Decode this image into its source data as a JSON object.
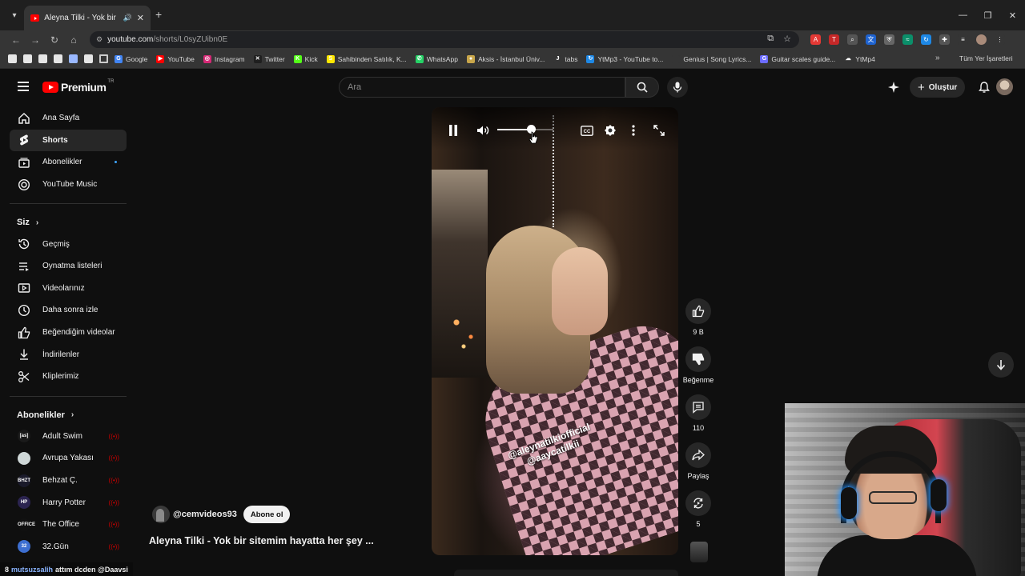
{
  "browser": {
    "tab_title": "Aleyna Tilki - Yok bir sitemim hayatta her şey",
    "url_host": "youtube.com",
    "url_path": "/shorts/L0syZUibn0E",
    "bookmarks": [
      {
        "label": "Google",
        "color": "#4285f4",
        "glyph": "G"
      },
      {
        "label": "YouTube",
        "color": "#ff0000",
        "glyph": "▶"
      },
      {
        "label": "Instagram",
        "color": "#d62976",
        "glyph": "◎"
      },
      {
        "label": "Twitter",
        "color": "#1f1f1f",
        "glyph": "✕"
      },
      {
        "label": "Kick",
        "color": "#53fc18",
        "glyph": "K"
      },
      {
        "label": "Sahibinden Satılık, K...",
        "color": "#ffe800",
        "glyph": "S"
      },
      {
        "label": "WhatsApp",
        "color": "#25d366",
        "glyph": "✆"
      },
      {
        "label": "Aksis - İstanbul Üniv...",
        "color": "#c8a64a",
        "glyph": "●"
      },
      {
        "label": "tabs",
        "color": "#353535",
        "glyph": "Ɉ"
      },
      {
        "label": "YtMp3 - YouTube to...",
        "color": "#1e88e5",
        "glyph": "↻"
      },
      {
        "label": "Genius | Song Lyrics...",
        "color": "#353535",
        "glyph": ""
      },
      {
        "label": "Guitar scales guide...",
        "color": "#6c6cff",
        "glyph": "G"
      },
      {
        "label": "YtMp4",
        "color": "#353535",
        "glyph": "☁"
      }
    ],
    "all_bookmarks_label": "Tüm Yer İşaretleri"
  },
  "header": {
    "logo_text": "Premium",
    "logo_region": "TR",
    "search_placeholder": "Ara",
    "create_label": "Oluştur"
  },
  "sidebar": {
    "main_items": [
      {
        "label": "Ana Sayfa",
        "icon": "home-icon"
      },
      {
        "label": "Shorts",
        "icon": "shorts-icon",
        "active": true
      },
      {
        "label": "Abonelikler",
        "icon": "subscriptions-icon",
        "has_dot": true
      },
      {
        "label": "YouTube Music",
        "icon": "music-icon"
      }
    ],
    "you_heading": "Siz",
    "you_items": [
      {
        "label": "Geçmiş",
        "icon": "history-icon"
      },
      {
        "label": "Oynatma listeleri",
        "icon": "playlist-icon"
      },
      {
        "label": "Videolarınız",
        "icon": "your-videos-icon"
      },
      {
        "label": "Daha sonra izle",
        "icon": "watch-later-icon"
      },
      {
        "label": "Beğendiğim videolar",
        "icon": "like-icon"
      },
      {
        "label": "İndirilenler",
        "icon": "download-icon"
      },
      {
        "label": "Kliplerimiz",
        "icon": "scissors-icon"
      }
    ],
    "subs_heading": "Abonelikler",
    "subscriptions": [
      {
        "label": "Adult Swim",
        "avatar_text": "[as]",
        "avatar_color": "#1a1a1a"
      },
      {
        "label": "Avrupa Yakası",
        "avatar_text": "",
        "avatar_color": "#cfd8d8"
      },
      {
        "label": "Behzat Ç.",
        "avatar_text": "BHZT",
        "avatar_color": "#1a1a2a"
      },
      {
        "label": "Harry Potter",
        "avatar_text": "HP",
        "avatar_color": "#2b2450"
      },
      {
        "label": "The Office",
        "avatar_text": "OFFICE",
        "avatar_color": "#111111"
      },
      {
        "label": "32.Gün",
        "avatar_text": "32",
        "avatar_color": "#3d6fd1"
      }
    ]
  },
  "short": {
    "overlay_line1": "@aleynatilkiofficial",
    "overlay_line2": "@aaycatilkii",
    "channel_handle": "@cemvideos93",
    "subscribe_label": "Abone ol",
    "title": "Aleyna Tilki - Yok bir sitemim hayatta her şey ...",
    "volume_level": 0.6
  },
  "actions": {
    "like_count": "9 B",
    "dislike_label": "Beğenme",
    "comment_count": "110",
    "share_label": "Paylaş",
    "remix_count": "5"
  },
  "status_bar": {
    "prefix": "8",
    "user": "mutsuzsalih",
    "text": "attım dcden @Daavsi"
  }
}
